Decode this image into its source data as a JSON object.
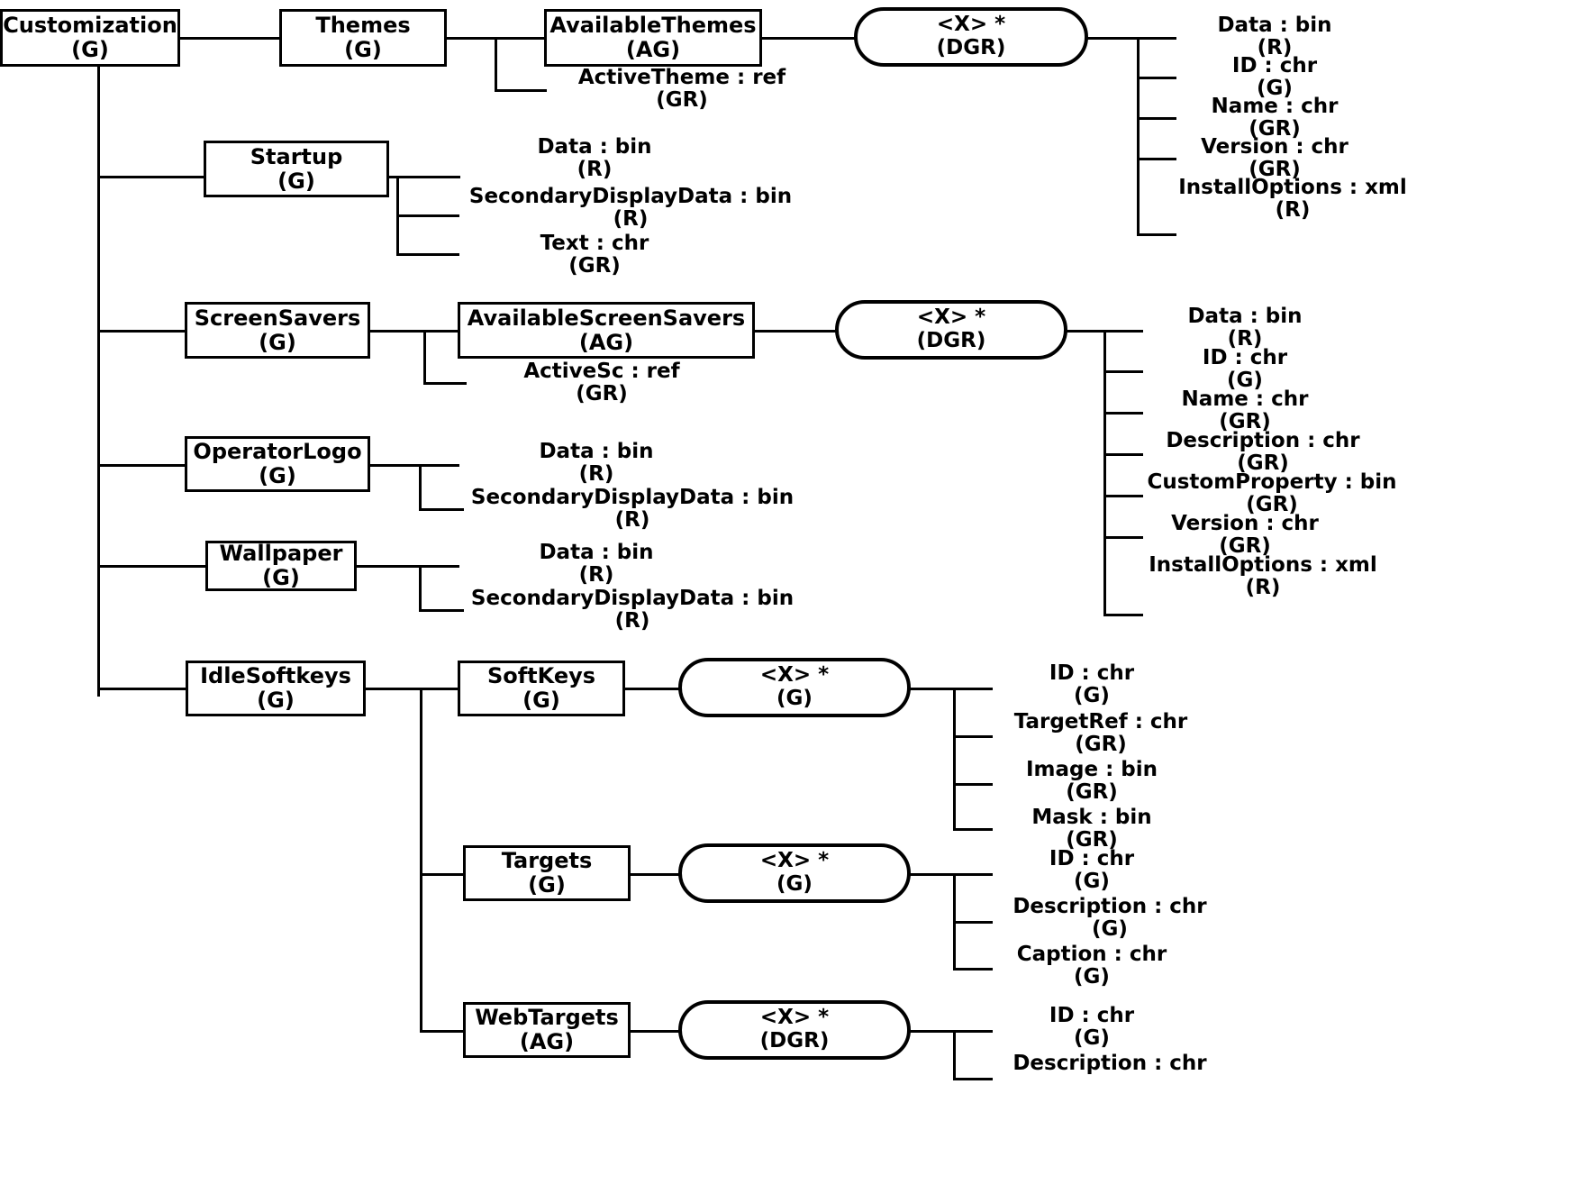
{
  "diagram": {
    "title": "Customization",
    "nodes": {
      "customization": {
        "name": "Customization",
        "kind": "(G)"
      },
      "themes": {
        "name": "Themes",
        "kind": "(G)"
      },
      "available_themes": {
        "name": "AvailableThemes",
        "kind": "(AG)"
      },
      "themes_item": {
        "name": "<X> *",
        "kind": "(DGR)"
      },
      "startup": {
        "name": "Startup",
        "kind": "(G)"
      },
      "screensavers": {
        "name": "ScreenSavers",
        "kind": "(G)"
      },
      "available_screensavers": {
        "name": "AvailableScreenSavers",
        "kind": "(AG)"
      },
      "screensaver_item": {
        "name": "<X> *",
        "kind": "(DGR)"
      },
      "operator_logo": {
        "name": "OperatorLogo",
        "kind": "(G)"
      },
      "wallpaper": {
        "name": "Wallpaper",
        "kind": "(G)"
      },
      "idle_softkeys": {
        "name": "IdleSoftkeys",
        "kind": "(G)"
      },
      "softkeys": {
        "name": "SoftKeys",
        "kind": "(G)"
      },
      "softkeys_item": {
        "name": "<X> *",
        "kind": "(G)"
      },
      "targets": {
        "name": "Targets",
        "kind": "(G)"
      },
      "targets_item": {
        "name": "<X> *",
        "kind": "(G)"
      },
      "webtargets": {
        "name": "WebTargets",
        "kind": "(AG)"
      },
      "webtargets_item": {
        "name": "<X> *",
        "kind": "(DGR)"
      }
    },
    "attributes": {
      "active_theme": {
        "name": "ActiveTheme : ref",
        "kind": "(GR)"
      },
      "theme_data": {
        "name": "Data : bin",
        "kind": "(R)"
      },
      "theme_id": {
        "name": "ID : chr",
        "kind": "(G)"
      },
      "theme_name": {
        "name": "Name : chr",
        "kind": "(GR)"
      },
      "theme_version": {
        "name": "Version : chr",
        "kind": "(GR)"
      },
      "theme_installoptions": {
        "name": "InstallOptions : xml",
        "kind": "(R)"
      },
      "startup_data": {
        "name": "Data : bin",
        "kind": "(R)"
      },
      "startup_secondary": {
        "name": "SecondaryDisplayData : bin",
        "kind": "(R)"
      },
      "startup_text": {
        "name": "Text : chr",
        "kind": "(GR)"
      },
      "active_sc": {
        "name": "ActiveSc : ref",
        "kind": "(GR)"
      },
      "ss_data": {
        "name": "Data : bin",
        "kind": "(R)"
      },
      "ss_id": {
        "name": "ID : chr",
        "kind": "(G)"
      },
      "ss_name": {
        "name": "Name : chr",
        "kind": "(GR)"
      },
      "ss_description": {
        "name": "Description : chr",
        "kind": "(GR)"
      },
      "ss_customproperty": {
        "name": "CustomProperty : bin",
        "kind": "(GR)"
      },
      "ss_version": {
        "name": "Version : chr",
        "kind": "(GR)"
      },
      "ss_installoptions": {
        "name": "InstallOptions : xml",
        "kind": "(R)"
      },
      "ol_data": {
        "name": "Data : bin",
        "kind": "(R)"
      },
      "ol_secondary": {
        "name": "SecondaryDisplayData : bin",
        "kind": "(R)"
      },
      "wp_data": {
        "name": "Data : bin",
        "kind": "(R)"
      },
      "wp_secondary": {
        "name": "SecondaryDisplayData : bin",
        "kind": "(R)"
      },
      "sk_id": {
        "name": "ID : chr",
        "kind": "(G)"
      },
      "sk_targetref": {
        "name": "TargetRef : chr",
        "kind": "(GR)"
      },
      "sk_image": {
        "name": "Image : bin",
        "kind": "(GR)"
      },
      "sk_mask": {
        "name": "Mask : bin",
        "kind": "(GR)"
      },
      "tg_id": {
        "name": "ID : chr",
        "kind": "(G)"
      },
      "tg_description": {
        "name": "Description : chr",
        "kind": "(G)"
      },
      "tg_caption": {
        "name": "Caption : chr",
        "kind": "(G)"
      },
      "wt_id": {
        "name": "ID : chr",
        "kind": "(G)"
      },
      "wt_description": {
        "name": "Description : chr",
        "kind": ""
      }
    }
  }
}
